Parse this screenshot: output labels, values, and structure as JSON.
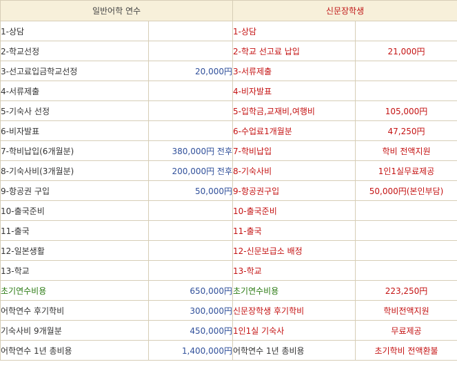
{
  "headers": {
    "left": "일반어학 연수",
    "right": "신문장학생"
  },
  "rows": [
    {
      "l_label": "1-상담",
      "l_amount": "",
      "r_label": "1-상담",
      "r_amount": ""
    },
    {
      "l_label": "2-학교선정",
      "l_amount": "",
      "r_label": "2-학교 선고료 납입",
      "r_amount": "21,000円"
    },
    {
      "l_label": "3-선고료입금학교선정",
      "l_amount": "20,000円",
      "r_label": "3-서류제출",
      "r_amount": ""
    },
    {
      "l_label": "4-서류제출",
      "l_amount": "",
      "r_label": "4-비자발표",
      "r_amount": ""
    },
    {
      "l_label": "5-기숙사 선정",
      "l_amount": "",
      "r_label": "5-입학금,교재비,여행비",
      "r_amount": "105,000円"
    },
    {
      "l_label": "6-비자발표",
      "l_amount": "",
      "r_label": "6-수업료1개월분",
      "r_amount": "47,250円"
    },
    {
      "l_label": "7-학비납입(6개월분)",
      "l_amount": "380,000円 전후",
      "r_label": "7-학비납입",
      "r_amount": "학비 전액지원"
    },
    {
      "l_label": "8-기숙사비(3개월분)",
      "l_amount": "200,000円 전후",
      "r_label": "8-기숙사비",
      "r_amount": "1인1실무료제공"
    },
    {
      "l_label": "9-항공권 구입",
      "l_amount": "50,000円",
      "r_label": "9-항공권구입",
      "r_amount": "50,000円(본인부담)"
    },
    {
      "l_label": "10-출국준비",
      "l_amount": "",
      "r_label": "10-출국준비",
      "r_amount": ""
    },
    {
      "l_label": "11-출국",
      "l_amount": "",
      "r_label": "11-출국",
      "r_amount": ""
    },
    {
      "l_label": "12-일본생활",
      "l_amount": "",
      "r_label": "12-신문보급소 배정",
      "r_amount": ""
    },
    {
      "l_label": "13-학교",
      "l_amount": "",
      "r_label": "13-학교",
      "r_amount": ""
    },
    {
      "l_label": "초기연수비용",
      "l_amount": "650,000円",
      "r_label": "초기연수비용",
      "r_amount": "223,250円"
    },
    {
      "l_label": "어학연수 후기학비",
      "l_amount": "300,000円",
      "r_label": "신문장학생 후기학비",
      "r_amount": "학비전액지원"
    },
    {
      "l_label": "기숙사비 9개월분",
      "l_amount": "450,000円",
      "r_label": "1인1실 기숙사",
      "r_amount": "무료제공"
    },
    {
      "l_label": "어학연수 1년 총비용",
      "l_amount": "1,400,000円",
      "r_label": "어학연수 1년 총비용",
      "r_amount": "초기학비 전액환불"
    }
  ],
  "colors": {
    "header_bg": "#f7f0da",
    "border": "#d6cdb6",
    "amount_blue": "#2f4f9a",
    "red": "#c41212",
    "green": "#2a7a12"
  }
}
